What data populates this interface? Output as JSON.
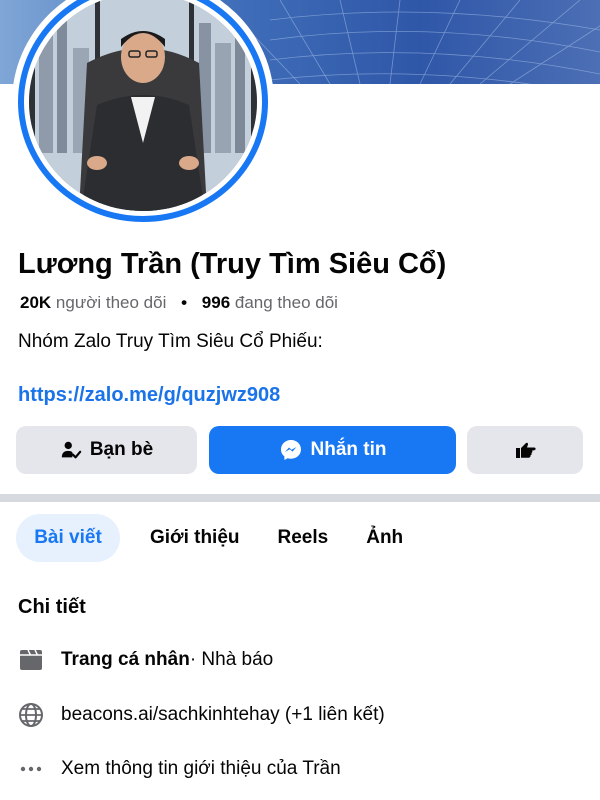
{
  "profile": {
    "name": "Lương Trần (Truy Tìm Siêu Cổ)",
    "followers_count": "20K",
    "followers_label": "người theo dõi",
    "separator": "•",
    "following_count": "996",
    "following_label": "đang theo dõi",
    "bio": "Nhóm Zalo Truy Tìm Siêu Cổ Phiếu:",
    "link": "https://zalo.me/g/quzjwz908"
  },
  "actions": {
    "friends_label": "Bạn bè",
    "friends_icon": "friend-check-icon",
    "message_label": "Nhắn tin",
    "message_icon": "messenger-icon",
    "more_icon": "hand-pointing-icon"
  },
  "tabs": [
    {
      "label": "Bài viết",
      "active": true
    },
    {
      "label": "Giới thiệu",
      "active": false
    },
    {
      "label": "Reels",
      "active": false
    },
    {
      "label": "Ảnh",
      "active": false
    }
  ],
  "details": {
    "title": "Chi tiết",
    "rows": [
      {
        "icon": "page-flag-icon",
        "bold": "Trang cá nhân",
        "text": " · Nhà báo"
      },
      {
        "icon": "globe-icon",
        "bold": "",
        "text": "beacons.ai/sachkinhtehay (+1 liên kết)"
      },
      {
        "icon": "more-dots-icon",
        "bold": "",
        "text": "Xem thông tin giới thiệu của Trần"
      }
    ]
  },
  "colors": {
    "accent": "#1877f2",
    "link": "#1a73e8",
    "button_gray": "#e4e6eb",
    "tab_active_bg": "#e7f0fd"
  }
}
